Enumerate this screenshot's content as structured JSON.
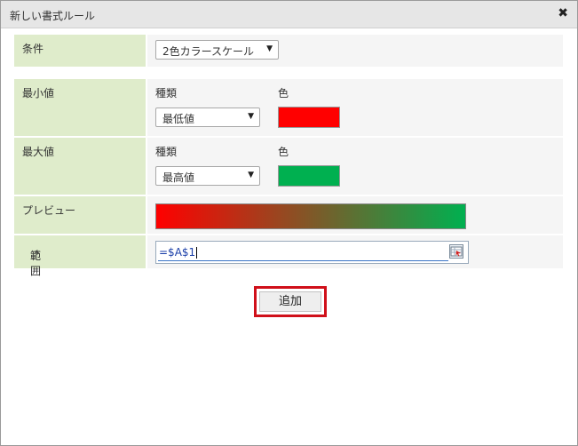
{
  "dialog": {
    "title": "新しい書式ルール"
  },
  "condition": {
    "label": "条件",
    "select_value": "2色カラースケール"
  },
  "min": {
    "label": "最小値",
    "type_label": "種類",
    "color_label": "色",
    "type_value": "最低値",
    "color": "#ff0000"
  },
  "max": {
    "label": "最大値",
    "type_label": "種類",
    "color_label": "色",
    "type_value": "最高値",
    "color": "#00b050"
  },
  "preview": {
    "label": "プレビュー",
    "gradient_start": "#ff0000",
    "gradient_end": "#00b050"
  },
  "range": {
    "label": "範囲",
    "required_mark": "*",
    "value": "=$A$1"
  },
  "add_button": {
    "label": "追加"
  }
}
